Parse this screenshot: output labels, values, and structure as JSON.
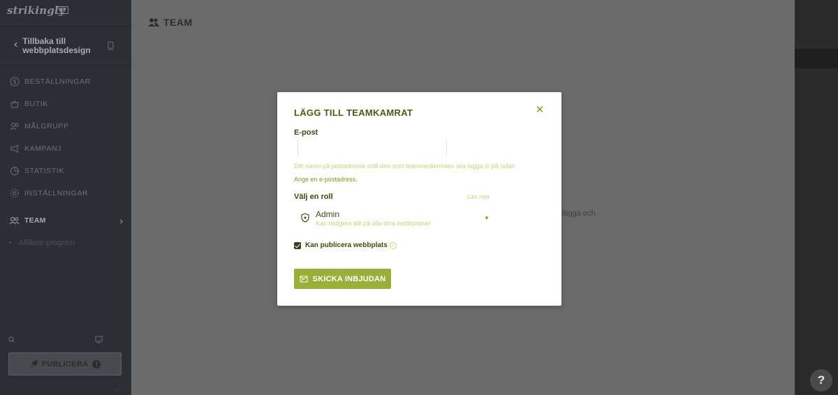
{
  "sidebar": {
    "logo": "strikingly",
    "logo_badge": "VIP",
    "back_label": "Tillbaka till webbplatsdesign",
    "nav_items": [
      {
        "label": "Beställningar",
        "icon": "dollar-icon"
      },
      {
        "label": "Butik",
        "icon": "shop-icon"
      },
      {
        "label": "Målgrupp",
        "icon": "audience-icon"
      },
      {
        "label": "Kampanj",
        "icon": "megaphone-icon"
      },
      {
        "label": "Statistik",
        "icon": "pie-chart-icon"
      },
      {
        "label": "Inställningar",
        "icon": "gear-icon"
      },
      {
        "label": "TEAM",
        "icon": "team-icon",
        "active": true
      }
    ],
    "sub_item": "Affiliate-program",
    "publish_label": "PUBLICERA",
    "publish_warning": "!"
  },
  "main": {
    "title": "TEAM",
    "bg_text": "lägga och"
  },
  "modal": {
    "title": "LÄGG TILL TEAMKAMRAT",
    "email_label": "E-post",
    "email_value": "",
    "email_hint": "Ditt namn på postadresse intill den som teammedlemmen ska logga in på sidan",
    "email_error": "Ange en e-postadress.",
    "role_label": "Välj en roll",
    "read_more": "Läs mer",
    "role_name": "Admin",
    "role_description": "Kan redigera allt på alla dina webbplatser",
    "checkbox_label": "Kan publicera webbplats",
    "checkbox_checked": true,
    "send_label": "SKICKA INBJUDAN"
  },
  "help_label": "?",
  "colors": {
    "accent": "#97b03a",
    "title_green": "#4d5a15",
    "sidebar_bg": "#2b2f34",
    "overlay": "#6b6b6b"
  }
}
